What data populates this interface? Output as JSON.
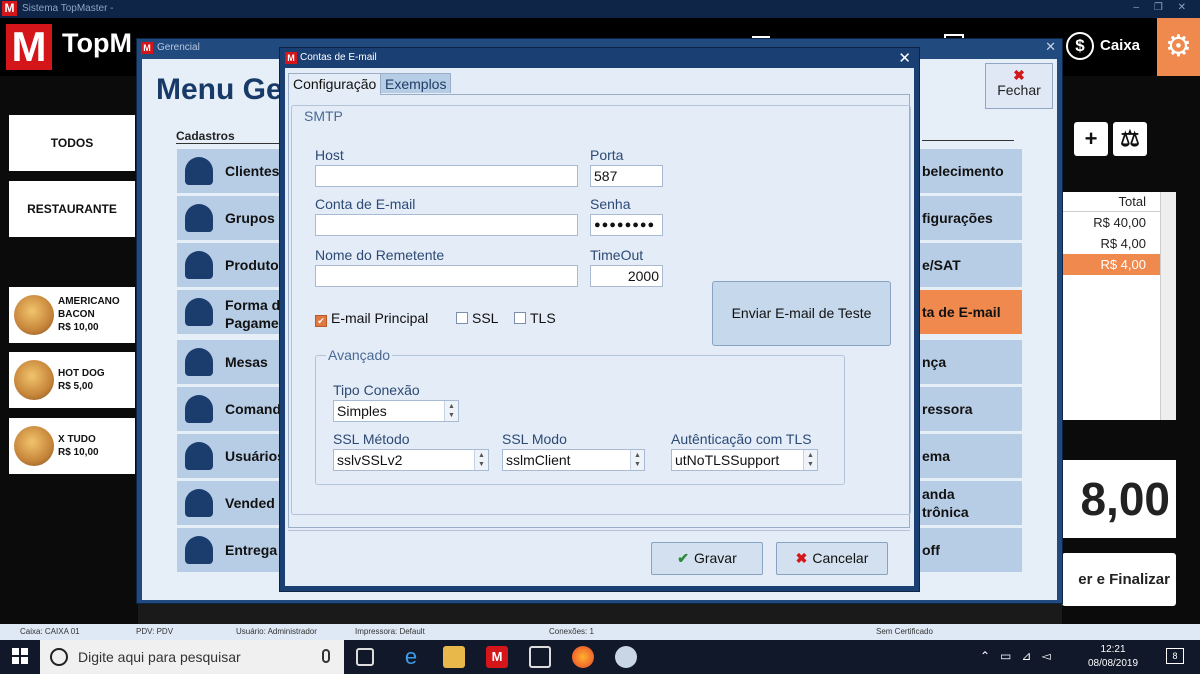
{
  "window": {
    "title": "Sistema TopMaster - ",
    "controls": "– ❐ ✕"
  },
  "header": {
    "app_name": "TopM",
    "caixa_label": "Caixa"
  },
  "left": {
    "categories": [
      "TODOS",
      "RESTAURANTE"
    ],
    "products": [
      {
        "name": "AMERICANO BACON",
        "line1": "AMERICANO",
        "line2": "BACON",
        "price": "R$ 10,00"
      },
      {
        "name": "HOT DOG",
        "line1": "HOT DOG",
        "line2": "",
        "price": "R$ 5,00"
      },
      {
        "name": "X TUDO",
        "line1": "X TUDO",
        "line2": "",
        "price": "R$ 10,00"
      }
    ]
  },
  "right": {
    "table_header": "Total",
    "col_first": "0",
    "rows": [
      {
        "prefix": "0",
        "total": "R$ 40,00"
      },
      {
        "prefix": "0",
        "total": "R$ 4,00"
      },
      {
        "prefix": "0",
        "total": "R$ 4,00"
      }
    ],
    "grand_total": "8,00",
    "finalize": "er e Finalizar",
    "add_icon": "+"
  },
  "gerencial": {
    "title": "Gerencial",
    "menu_title": "Menu Ge",
    "close_label": "Fechar",
    "section_cadastros": "Cadastros",
    "left_items": [
      "Clientes",
      "Grupos",
      "Produto",
      "Forma de Pagame",
      "Mesas",
      "Comand",
      "Usuários",
      "Vended",
      "Entrega"
    ],
    "forma_line1": "Forma d",
    "forma_line2": "Pagame",
    "right_items": [
      "belecimento",
      "figurações",
      "e/SAT",
      "ta de E-mail",
      "nça",
      "ressora",
      "ema",
      "anda trônica",
      "off"
    ],
    "comanda_line1": "anda",
    "comanda_line2": "trônica"
  },
  "dialog": {
    "title": "Contas de E-mail",
    "tabs": [
      "Configuração",
      "Exemplos"
    ],
    "smtp_label": "SMTP",
    "host_label": "Host",
    "host_value": "",
    "porta_label": "Porta",
    "porta_value": "587",
    "conta_label": "Conta de E-mail",
    "conta_value": "",
    "senha_label": "Senha",
    "senha_value": "●●●●●●●●",
    "remetente_label": "Nome do Remetente",
    "remetente_value": "",
    "timeout_label": "TimeOut",
    "timeout_value": "2000",
    "test_button": "Enviar E-mail de Teste",
    "chk_principal": "E-mail Principal",
    "chk_principal_checked": true,
    "chk_ssl": "SSL",
    "chk_tls": "TLS",
    "avancado_label": "Avançado",
    "tipo_conexao_label": "Tipo Conexão",
    "tipo_conexao_value": "Simples",
    "ssl_metodo_label": "SSL Método",
    "ssl_metodo_value": "sslvSSLv2",
    "ssl_modo_label": "SSL Modo",
    "ssl_modo_value": "sslmClient",
    "auth_tls_label": "Autênticação com TLS",
    "auth_tls_value": "utNoTLSSupport",
    "save_label": "Gravar",
    "cancel_label": "Cancelar"
  },
  "statusbar": {
    "caixa": "Caixa: CAIXA 01",
    "pdv": "PDV: PDV",
    "usuario": "Usuário: Administrador",
    "impressora": "Impressora: Default",
    "conexoes": "Conexões: 1",
    "certificado": "Sem Certificado"
  },
  "taskbar": {
    "search_placeholder": "Digite aqui para pesquisar",
    "time": "12:21",
    "date": "08/08/2019",
    "notifications": "8"
  },
  "colors": {
    "accent": "#f0894d",
    "brand_red": "#d4161a",
    "window_blue": "#1a3f73"
  }
}
